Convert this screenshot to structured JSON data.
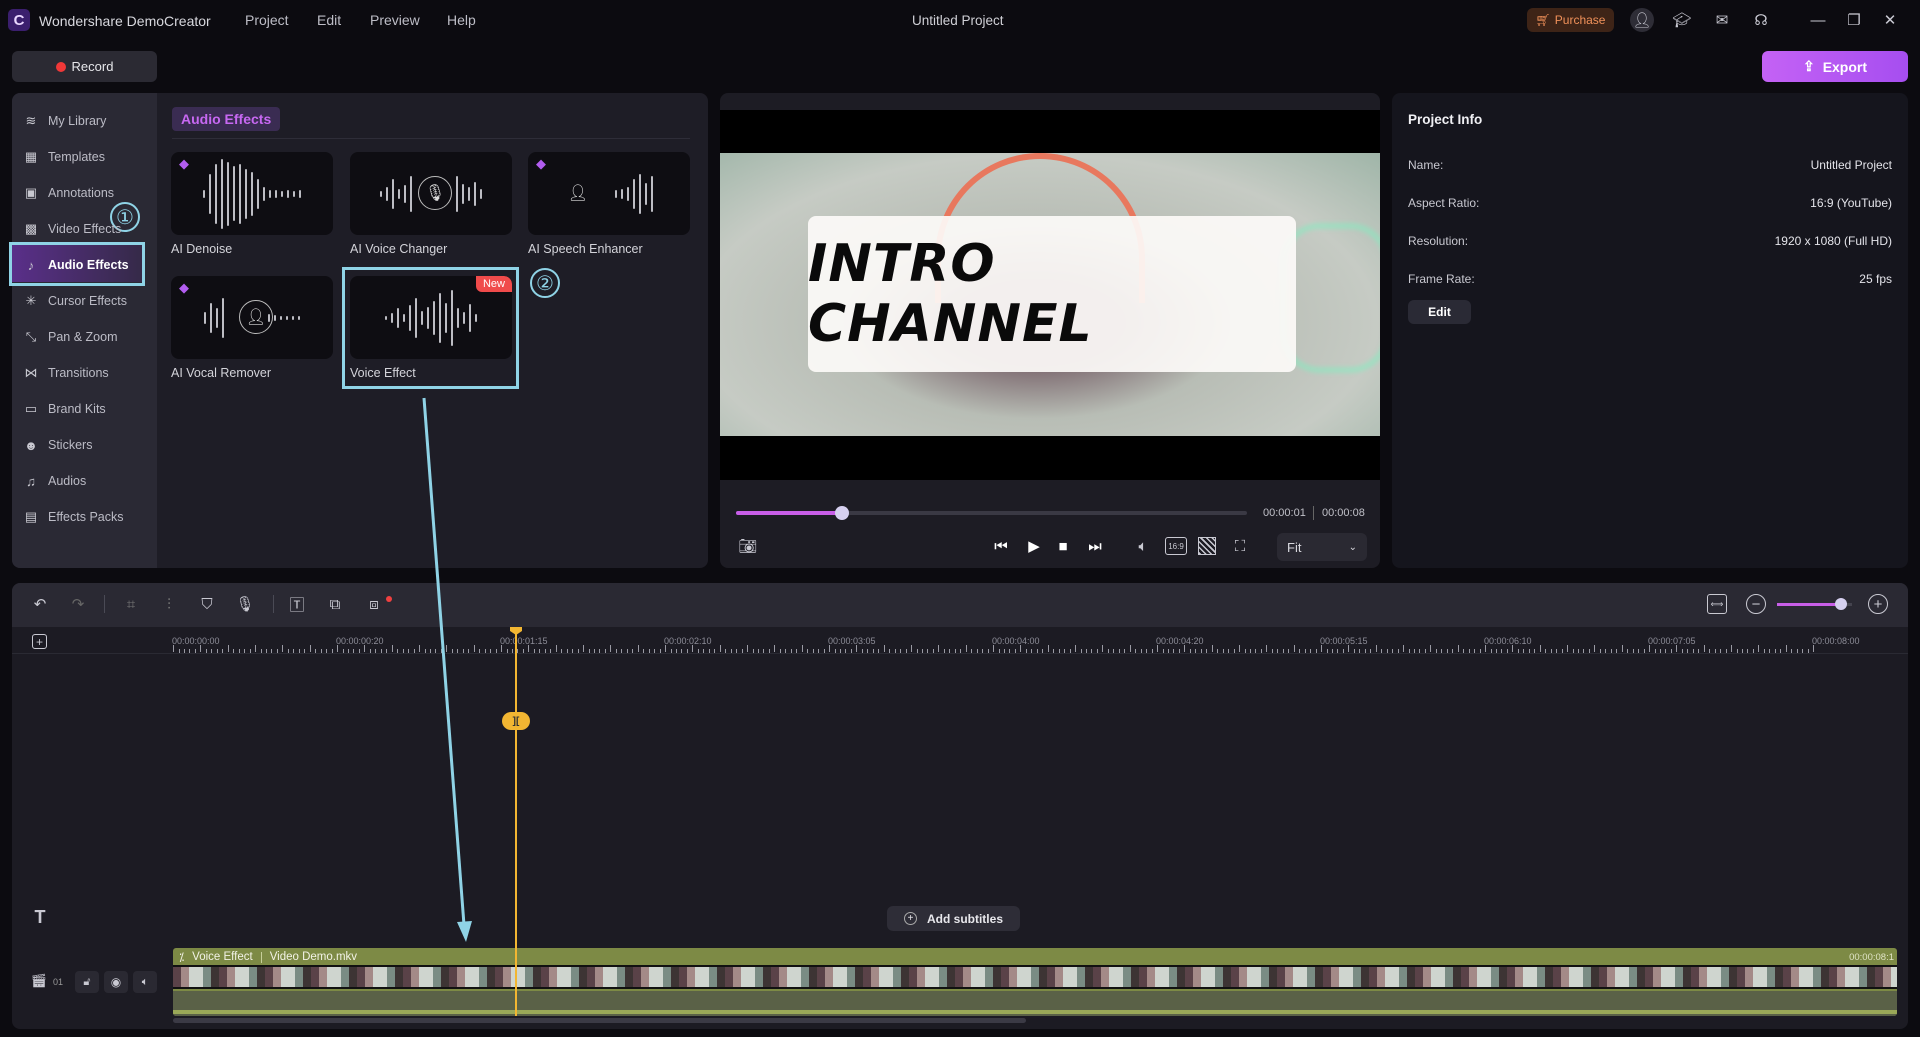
{
  "app": {
    "name": "Wondershare DemoCreator",
    "title": "Untitled Project",
    "menu": [
      "Project",
      "Edit",
      "Preview",
      "Help"
    ],
    "purchase": "Purchase",
    "record": "Record",
    "export": "Export"
  },
  "colors": {
    "accent": "#b05ef0",
    "highlight": "#8fd3e6",
    "playhead": "#f2b632",
    "clip": "#7d8a45",
    "new_badge": "#f04b4b"
  },
  "sidebar": {
    "items": [
      {
        "label": "My Library",
        "icon": "layers-icon",
        "glyph": "≋"
      },
      {
        "label": "Templates",
        "icon": "templates-icon",
        "glyph": "▦"
      },
      {
        "label": "Annotations",
        "icon": "annotation-icon",
        "glyph": "▣"
      },
      {
        "label": "Video Effects",
        "icon": "video-effects-icon",
        "glyph": "▩"
      },
      {
        "label": "Audio Effects",
        "icon": "music-note-icon",
        "glyph": "♪",
        "active": true
      },
      {
        "label": "Cursor Effects",
        "icon": "cursor-effects-icon",
        "glyph": "✳"
      },
      {
        "label": "Pan & Zoom",
        "icon": "pan-zoom-icon",
        "glyph": "⤡"
      },
      {
        "label": "Transitions",
        "icon": "transitions-icon",
        "glyph": "⋈"
      },
      {
        "label": "Brand Kits",
        "icon": "brand-kits-icon",
        "glyph": "▭"
      },
      {
        "label": "Stickers",
        "icon": "sticker-icon",
        "glyph": "☻"
      },
      {
        "label": "Audios",
        "icon": "audio-icon",
        "glyph": "♫"
      },
      {
        "label": "Effects Packs",
        "icon": "effects-packs-icon",
        "glyph": "▤"
      }
    ]
  },
  "library": {
    "tab": "Audio Effects",
    "cards": [
      {
        "label": "AI Denoise",
        "premium": true
      },
      {
        "label": "AI Voice Changer",
        "premium": false
      },
      {
        "label": "AI Speech Enhancer",
        "premium": true
      },
      {
        "label": "AI Vocal Remover",
        "premium": true
      },
      {
        "label": "Voice Effect",
        "premium": false,
        "badge": "New"
      }
    ]
  },
  "annotations": {
    "step1": "①",
    "step2": "②"
  },
  "preview": {
    "overlay_text": "INTRO CHANNEL",
    "current_time": "00:00:01",
    "total_time": "00:00:08",
    "progress": 0.125,
    "zoom_select": "Fit",
    "aspect_icon": "16:9"
  },
  "project_info": {
    "title": "Project Info",
    "rows": [
      {
        "label": "Name:",
        "value": "Untitled Project"
      },
      {
        "label": "Aspect Ratio:",
        "value": "16:9 (YouTube)"
      },
      {
        "label": "Resolution:",
        "value": "1920 x 1080 (Full HD)"
      },
      {
        "label": "Frame Rate:",
        "value": "25 fps"
      }
    ],
    "edit": "Edit"
  },
  "timeline": {
    "ruler": [
      "00:00:00:00",
      "00:00:00:20",
      "00:00:01:15",
      "00:00:02:10",
      "00:00:03:05",
      "00:00:04:00",
      "00:00:04:20",
      "00:00:05:15",
      "00:00:06:10",
      "00:00:07:05",
      "00:00:08:00"
    ],
    "zoom_level": 0.85,
    "add_subtitles": "Add subtitles",
    "track_number": "01",
    "clip": {
      "effect": "Voice Effect",
      "file": "Video Demo.mkv",
      "end_time": "00:00:08:1"
    }
  }
}
